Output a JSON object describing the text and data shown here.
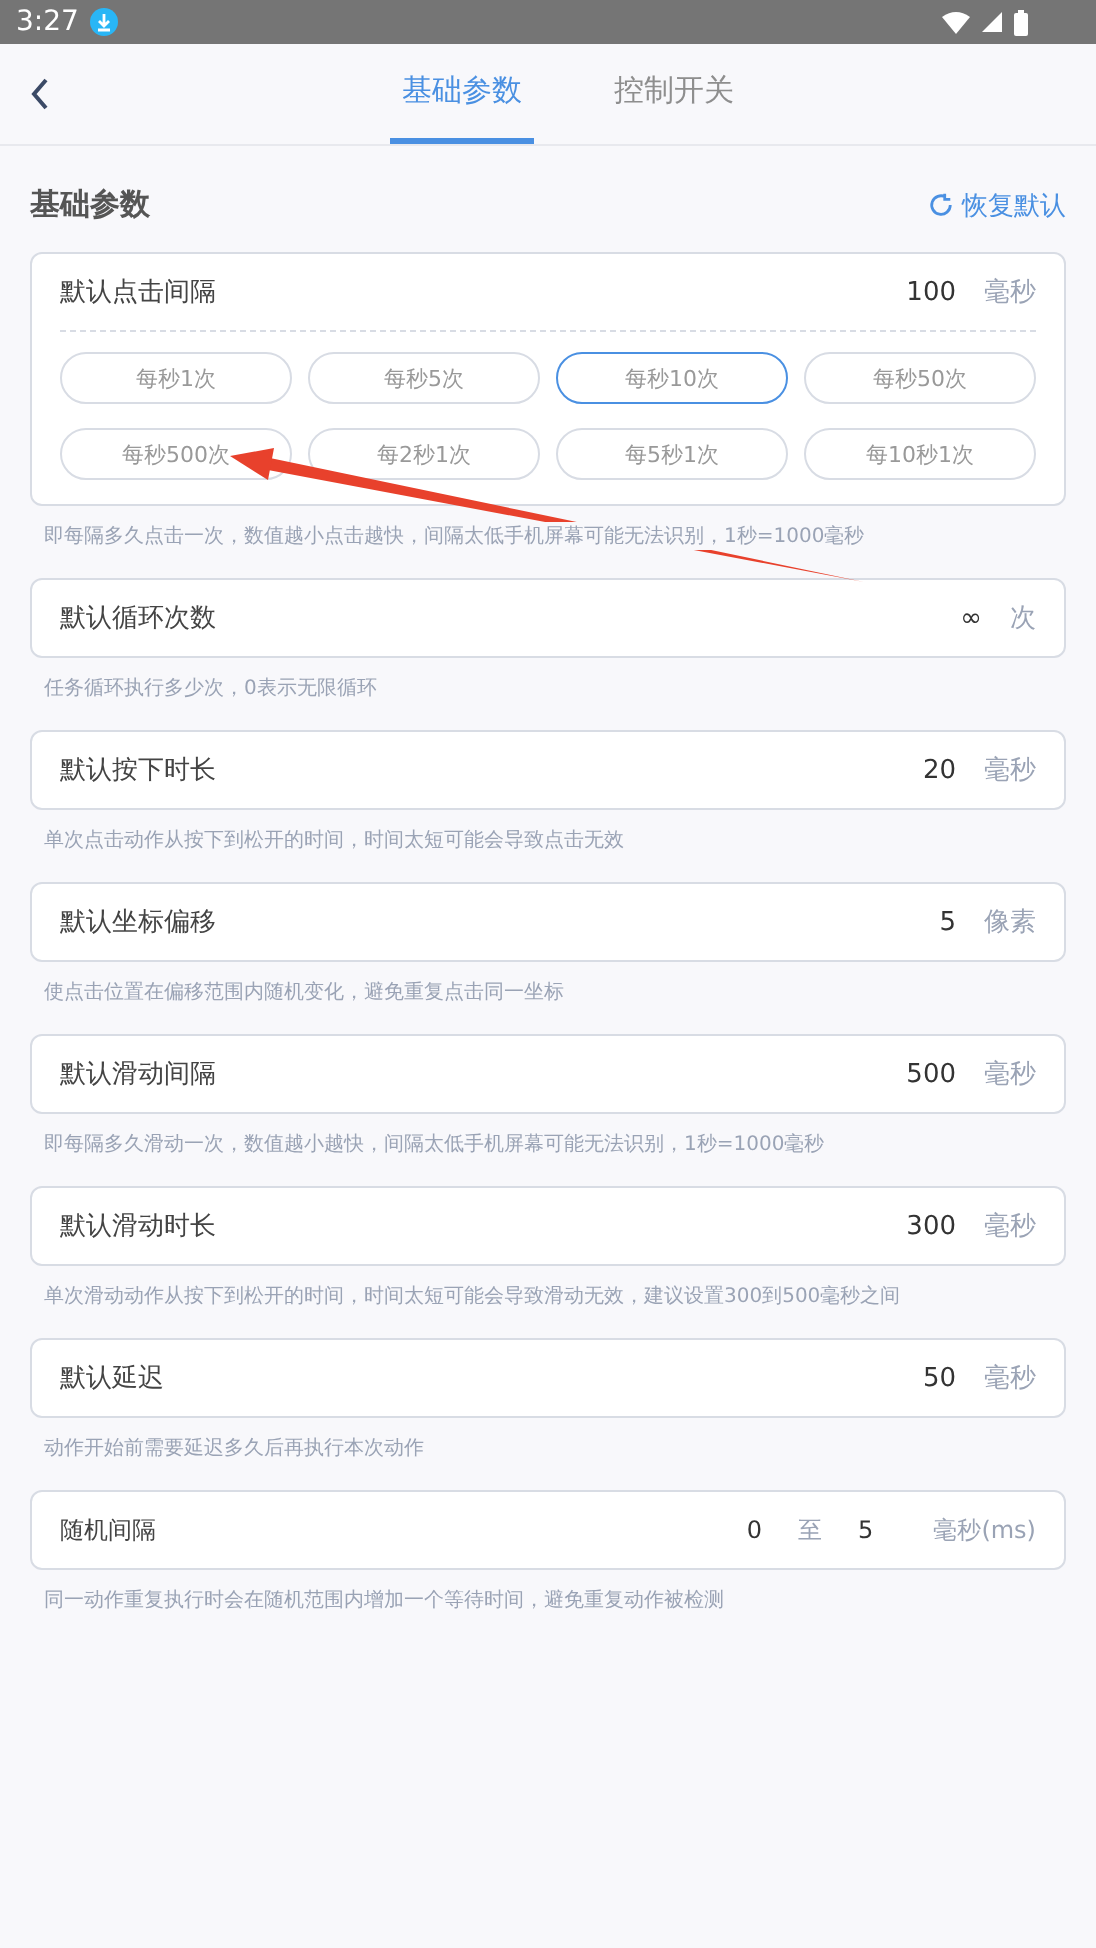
{
  "status_bar": {
    "time": "3:27"
  },
  "tabs": [
    {
      "label": "基础参数",
      "selected": true
    },
    {
      "label": "控制开关",
      "selected": false
    }
  ],
  "section": {
    "title": "基础参数",
    "reset": "恢复默认"
  },
  "settings": [
    {
      "kind": "presets",
      "label": "默认点击间隔",
      "value": "100",
      "unit": "毫秒",
      "hint": "即每隔多久点击一次，数值越小点击越快，间隔太低手机屏幕可能无法识别，1秒=1000毫秒",
      "presets": [
        {
          "label": "每秒1次",
          "selected": false
        },
        {
          "label": "每秒5次",
          "selected": false
        },
        {
          "label": "每秒10次",
          "selected": true
        },
        {
          "label": "每秒50次",
          "selected": false
        },
        {
          "label": "每秒500次",
          "selected": false
        },
        {
          "label": "每2秒1次",
          "selected": false
        },
        {
          "label": "每5秒1次",
          "selected": false
        },
        {
          "label": "每10秒1次",
          "selected": false
        }
      ]
    },
    {
      "kind": "number",
      "label": "默认循环次数",
      "value": "∞",
      "unit": "次",
      "hint": "任务循环执行多少次，0表示无限循环"
    },
    {
      "kind": "number",
      "label": "默认按下时长",
      "value": "20",
      "unit": "毫秒",
      "hint": "单次点击动作从按下到松开的时间，时间太短可能会导致点击无效"
    },
    {
      "kind": "number",
      "label": "默认坐标偏移",
      "value": "5",
      "unit": "像素",
      "hint": "使点击位置在偏移范围内随机变化，避免重复点击同一坐标"
    },
    {
      "kind": "number",
      "label": "默认滑动间隔",
      "value": "500",
      "unit": "毫秒",
      "hint": "即每隔多久滑动一次，数值越小越快，间隔太低手机屏幕可能无法识别，1秒=1000毫秒"
    },
    {
      "kind": "number",
      "label": "默认滑动时长",
      "value": "300",
      "unit": "毫秒",
      "hint": "单次滑动动作从按下到松开的时间，时间太短可能会导致滑动无效，建议设置300到500毫秒之间"
    },
    {
      "kind": "number",
      "label": "默认延迟",
      "value": "50",
      "unit": "毫秒",
      "hint": "动作开始前需要延迟多久后再执行本次动作"
    },
    {
      "kind": "range",
      "label": "随机间隔",
      "min": "0",
      "to": "至",
      "max": "5",
      "unit": "毫秒(ms)",
      "hint": "同一动作重复执行时会在随机范围内增加一个等待时间，避免重复动作被检测"
    }
  ]
}
